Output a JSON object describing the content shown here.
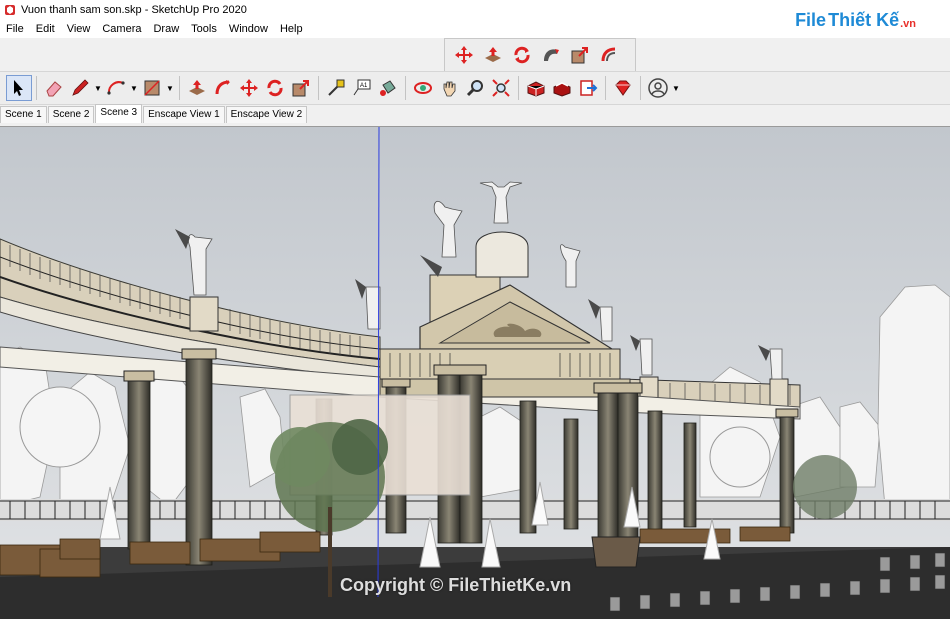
{
  "window": {
    "title": "Vuon thanh sam son.skp - SketchUp Pro 2020"
  },
  "menu": [
    "File",
    "Edit",
    "View",
    "Camera",
    "Draw",
    "Tools",
    "Window",
    "Help"
  ],
  "watermark": {
    "part1": "File",
    "part2": "Thiết Kế",
    ".vn": ".vn",
    "suffix": ".vn"
  },
  "float_toolbar": [
    "move-icon",
    "push-pull-icon",
    "rotate-icon",
    "follow-me-icon",
    "scale-icon",
    "offset-icon"
  ],
  "main_toolbar": [
    "select-icon",
    "eraser-icon",
    "pencil-icon",
    "arc-icon",
    "rectangle-icon",
    "push-pull-icon",
    "follow-me-icon",
    "move-icon",
    "rotate-icon",
    "scale-icon",
    "tape-measure-icon",
    "text-icon",
    "paint-bucket-icon",
    "orbit-icon",
    "pan-icon",
    "zoom-icon",
    "zoom-extents-icon",
    "warehouse-icon",
    "extension-warehouse-icon",
    "send-to-layout-icon",
    "ruby-icon",
    "account-icon"
  ],
  "scenes": [
    "Scene 1",
    "Scene 2",
    "Scene 3",
    "Enscape View 1",
    "Enscape View 2"
  ],
  "active_scene": "Scene 3",
  "copyright": "Copyright © FileThietKe.vn",
  "colors": {
    "accent": "#1e8ad6",
    "brand_red": "#e8302a",
    "sky": "#cfd3d8",
    "stone": "#d8cdb4"
  }
}
